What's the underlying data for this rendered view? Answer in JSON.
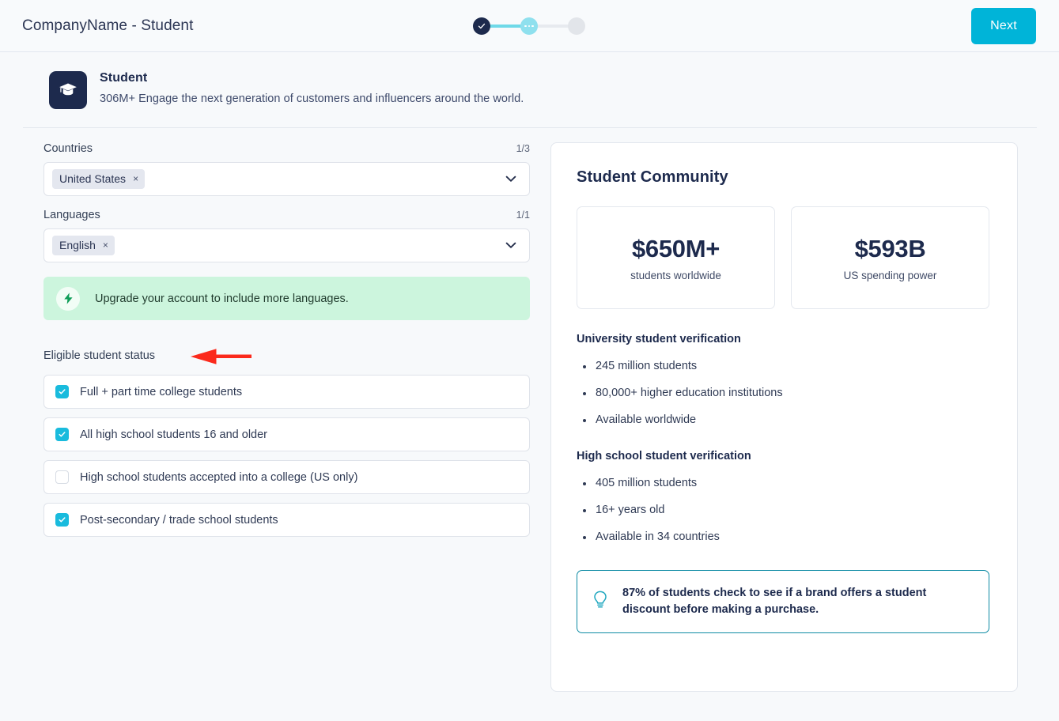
{
  "topbar": {
    "title": "CompanyName - Student",
    "next_label": "Next",
    "stepper": {
      "steps": [
        "completed",
        "current",
        "upcoming"
      ]
    }
  },
  "hero": {
    "icon": "graduation-cap-icon",
    "title": "Student",
    "subtitle": "306M+ Engage the next generation of customers and influencers around the world."
  },
  "form": {
    "countries": {
      "label": "Countries",
      "count": "1/3",
      "tags": [
        {
          "label": "United States",
          "remove": "×"
        }
      ],
      "chevron": "chevron-down-icon"
    },
    "languages": {
      "label": "Languages",
      "count": "1/1",
      "tags": [
        {
          "label": "English",
          "remove": "×"
        }
      ],
      "chevron": "chevron-down-icon"
    },
    "upgrade_banner": {
      "icon": "lightning-bolt-icon",
      "text": "Upgrade your account to include more languages."
    },
    "eligible": {
      "label": "Eligible student status",
      "annotation": "red-left-arrow",
      "options": [
        {
          "label": "Full + part time college students",
          "checked": true
        },
        {
          "label": "All high school students 16 and older",
          "checked": true
        },
        {
          "label": "High school students accepted into a college (US only)",
          "checked": false
        },
        {
          "label": "Post-secondary / trade school students",
          "checked": true
        }
      ]
    }
  },
  "panel": {
    "title": "Student Community",
    "stats": [
      {
        "value": "$650M+",
        "label": "students worldwide"
      },
      {
        "value": "$593B",
        "label": "US spending power"
      }
    ],
    "sections": [
      {
        "heading": "University student verification",
        "items": [
          "245 million students",
          "80,000+ higher education institutions",
          "Available worldwide"
        ]
      },
      {
        "heading": "High school student verification",
        "items": [
          "405 million students",
          "16+ years old",
          "Available in 34 countries"
        ]
      }
    ],
    "tip": {
      "icon": "lightbulb-icon",
      "text": "87% of students check to see if a brand offers a student discount before making a purchase."
    }
  },
  "colors": {
    "accent_cyan": "#00b4d8",
    "navy": "#1d2a4d",
    "banner_green_bg": "#ccf5dd",
    "banner_green_icon": "#0f9d58",
    "tip_border": "#0d8ba4",
    "annotation_red": "#fb2a1c",
    "page_bg": "#f7f9fb"
  }
}
